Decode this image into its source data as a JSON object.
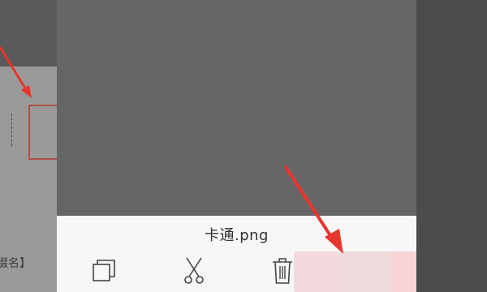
{
  "sheet": {
    "file_name": "卡通.png"
  },
  "background": {
    "partial_text": "缀名】"
  },
  "actions": [
    {
      "icon": "copy-icon"
    },
    {
      "icon": "scissors-icon"
    },
    {
      "icon": "trash-icon"
    }
  ],
  "colors": {
    "annotation_red": "#e8352e",
    "sheet_bg": "#f7f7f7",
    "preview_bg": "#666666"
  }
}
